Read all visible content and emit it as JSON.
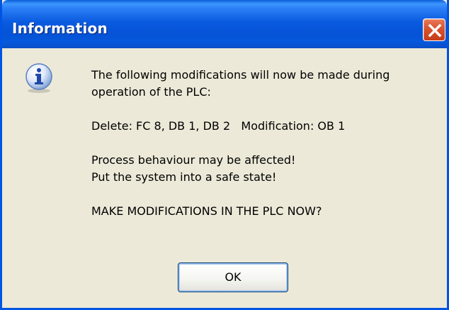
{
  "window": {
    "title": "Information"
  },
  "titlebar": {
    "close_icon": "close-icon"
  },
  "dialog": {
    "icon": "info-icon",
    "lines": [
      "The following modifications will now be made during",
      "operation of the PLC:",
      "",
      "Delete: FC 8, DB 1, DB 2   Modification: OB 1",
      "",
      "Process behaviour may be affected!",
      "Put the system into a safe state!",
      "",
      "MAKE MODIFICATIONS IN THE PLC NOW?"
    ],
    "ok_label": "OK"
  },
  "colors": {
    "titlebar": "#0553d6",
    "face": "#ece9d8",
    "close": "#d9532f"
  }
}
